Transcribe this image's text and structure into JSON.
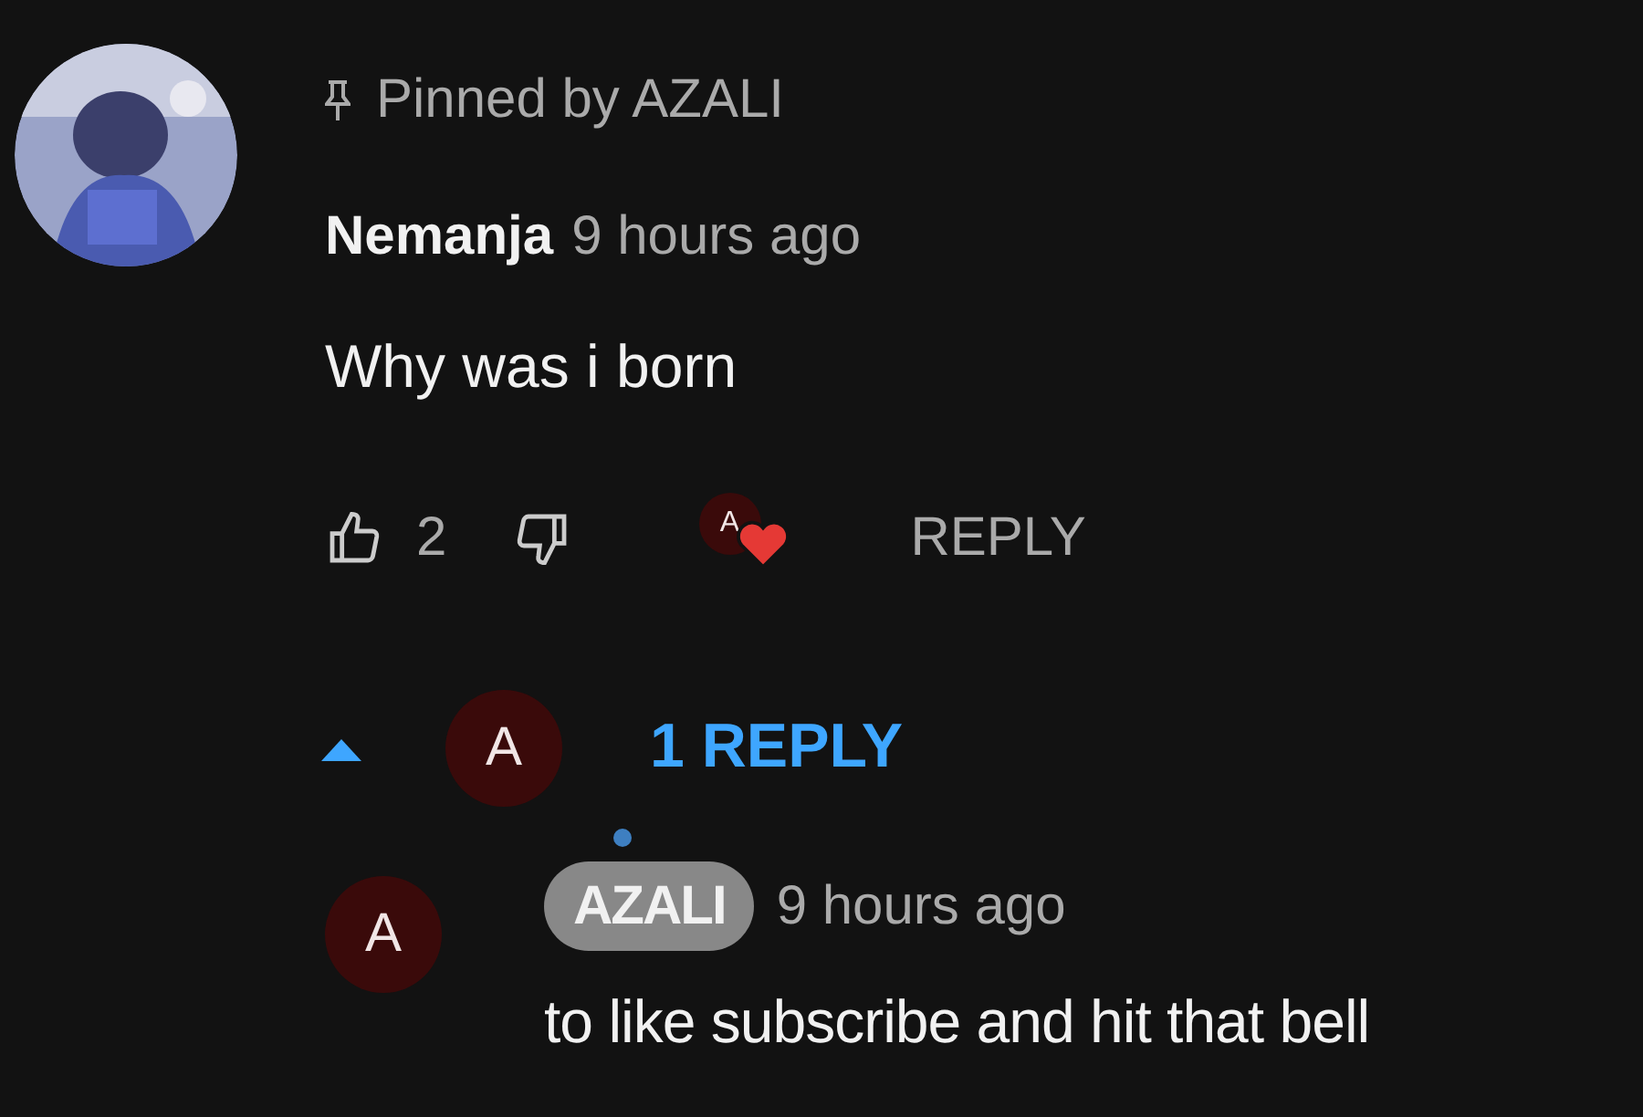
{
  "pinned": {
    "label": "Pinned by AZALI"
  },
  "comment": {
    "author": "Nemanja",
    "time": "9 hours ago",
    "text": "Why was i born",
    "likes": "2",
    "heart_avatar": "A",
    "reply_label": "REPLY"
  },
  "replies_toggle": {
    "expanded": true,
    "avatar": "A",
    "label": "1 REPLY"
  },
  "replies": [
    {
      "avatar": "A",
      "author": "AZALI",
      "author_is_creator": true,
      "time": "9 hours ago",
      "text": "to like subscribe and hit that bell"
    }
  ]
}
